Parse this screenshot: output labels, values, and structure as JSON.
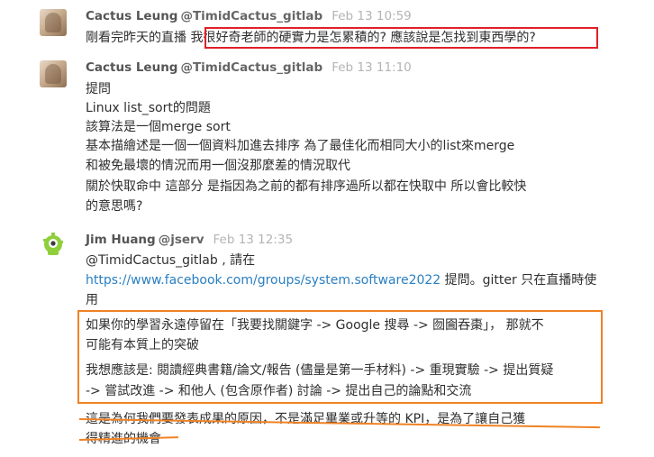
{
  "messages": [
    {
      "author": "Cactus Leung",
      "handle": "@TimidCactus_gitlab",
      "time": "Feb 13 10:59",
      "lines": [
        {
          "pre": "剛看完昨天的直播 ",
          "highlighted": "我很好奇老師的硬實力是怎累積的? 應該說是怎找到東西學的?"
        }
      ]
    },
    {
      "author": "Cactus Leung",
      "handle": "@TimidCactus_gitlab",
      "time": "Feb 13 11:10",
      "lines": [
        "提問",
        "Linux list_sort的問題",
        "該算法是一個merge sort",
        "基本描繪述是一個一個資料加進去排序 為了最佳化而相同大小的list來merge",
        "和被免最壞的情況而用一個沒那麼差的情況取代",
        "關於快取命中 這部分 是指因為之前的都有排序過所以都在快取中 所以會比較快",
        "的意思嗎?"
      ]
    },
    {
      "author": "Jim Huang",
      "handle": "@jserv",
      "time": "Feb 13 12:35",
      "mention": "@TimidCactus_gitlab",
      "mention_suffix": " , 請在",
      "link": "https://www.facebook.com/groups/system.software2022",
      "link_suffix": " 提問。gitter 只在直播時使",
      "line3": "用",
      "quote_lines": [
        "如果你的學習永遠停留在「我要找關鍵字 -> Google 搜尋 -> 囫圇吞棗」， 那就不",
        "可能有本質上的突破",
        "我想應該是: 閱讀經典書籍/論文/報告 (儘量是第一手材料) -> 重現實驗 -> 提出質疑",
        "-> 嘗試改進 -> 和他人 (包含原作者) 討論 -> 提出自己的論點和交流"
      ],
      "struck_lines": [
        "這是為何我們要發表成果的原因，不是滿足畢業或升等的 KPI，是為了讓自己獲",
        "得精進的機會"
      ]
    }
  ],
  "colors": {
    "highlight_red": "#e0202a",
    "highlight_orange": "#f08224",
    "link": "#2a7fc1",
    "jim_avatar_green": "#8fcf3c"
  }
}
